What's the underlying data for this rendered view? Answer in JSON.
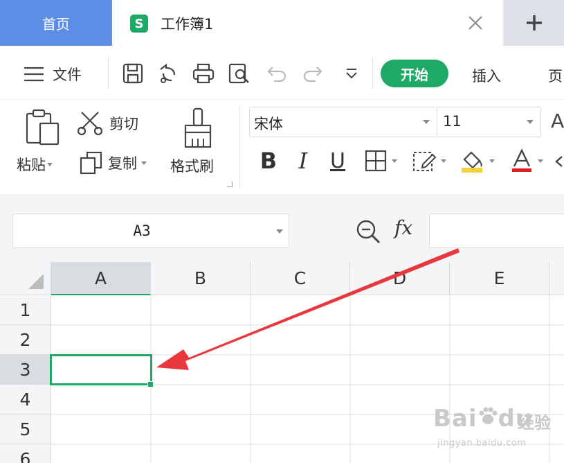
{
  "tabs": {
    "home": "首页",
    "doc_icon": "S",
    "doc_title": "工作簿1"
  },
  "menu": {
    "file": "文件",
    "start": "开始",
    "insert": "插入",
    "page_partial": "页"
  },
  "ribbon": {
    "paste": "粘贴",
    "cut": "剪切",
    "copy": "复制",
    "format_painter": "格式刷",
    "font_name": "宋体",
    "font_size": "11",
    "bold": "B",
    "italic": "I",
    "underline": "U",
    "font_grow_partial": "A"
  },
  "formula_bar": {
    "name_box": "A3",
    "fx": "fx",
    "formula": ""
  },
  "grid": {
    "columns": [
      "A",
      "B",
      "C",
      "D",
      "E"
    ],
    "rows": [
      "1",
      "2",
      "3",
      "4",
      "5",
      "6"
    ],
    "active_column": "A",
    "active_row": "3"
  },
  "watermark": {
    "brand": "Bai",
    "brand_tail": "du",
    "jingyan": "经验",
    "url": "jingyan.baidu.com"
  },
  "colors": {
    "accent_green": "#1eaa66",
    "home_tab_blue": "#5c8ee6",
    "arrow_red": "#e8383d"
  },
  "icons": {
    "hamburger": "menu-icon",
    "save": "save-icon",
    "export": "export-icon",
    "print": "print-icon",
    "preview": "print-preview-icon",
    "undo": "undo-icon",
    "redo": "redo-icon",
    "more": "more-icon"
  }
}
